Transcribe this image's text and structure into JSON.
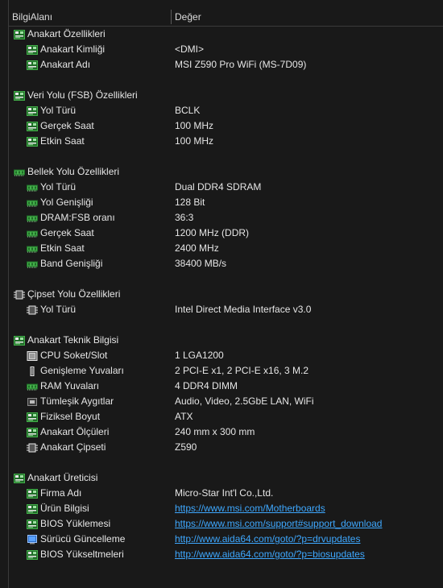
{
  "header": {
    "col_field": "BilgiAlanı",
    "col_value": "Değer"
  },
  "groups": [
    {
      "title": "Anakart Özellikleri",
      "icon": "board-icon",
      "items": [
        {
          "label": "Anakart Kimliği",
          "value": "<DMI>",
          "icon": "board-icon"
        },
        {
          "label": "Anakart Adı",
          "value": "MSI Z590 Pro WiFi (MS-7D09)",
          "icon": "board-icon"
        }
      ]
    },
    {
      "title": "Veri Yolu (FSB) Özellikleri",
      "icon": "board-icon",
      "items": [
        {
          "label": "Yol Türü",
          "value": "BCLK",
          "icon": "board-icon"
        },
        {
          "label": "Gerçek Saat",
          "value": "100 MHz",
          "icon": "board-icon"
        },
        {
          "label": "Etkin Saat",
          "value": "100 MHz",
          "icon": "board-icon"
        }
      ]
    },
    {
      "title": "Bellek Yolu Özellikleri",
      "icon": "memory-icon",
      "items": [
        {
          "label": "Yol Türü",
          "value": "Dual DDR4 SDRAM",
          "icon": "memory-icon"
        },
        {
          "label": "Yol Genişliği",
          "value": "128 Bit",
          "icon": "memory-icon"
        },
        {
          "label": "DRAM:FSB oranı",
          "value": "36:3",
          "icon": "memory-icon"
        },
        {
          "label": "Gerçek Saat",
          "value": "1200 MHz (DDR)",
          "icon": "memory-icon"
        },
        {
          "label": "Etkin Saat",
          "value": "2400 MHz",
          "icon": "memory-icon"
        },
        {
          "label": "Band Genişliği",
          "value": "38400 MB/s",
          "icon": "memory-icon"
        }
      ]
    },
    {
      "title": "Çipset Yolu Özellikleri",
      "icon": "chipset-icon",
      "items": [
        {
          "label": "Yol Türü",
          "value": "Intel Direct Media Interface v3.0",
          "icon": "chipset-icon"
        }
      ]
    },
    {
      "title": "Anakart Teknik Bilgisi",
      "icon": "board-icon",
      "items": [
        {
          "label": "CPU Soket/Slot",
          "value": "1 LGA1200",
          "icon": "cpu-socket-icon"
        },
        {
          "label": "Genişleme Yuvaları",
          "value": "2 PCI-E x1, 2 PCI-E x16, 3 M.2",
          "icon": "expansion-slot-icon"
        },
        {
          "label": "RAM Yuvaları",
          "value": "4 DDR4 DIMM",
          "icon": "memory-icon"
        },
        {
          "label": "Tümleşik Aygıtlar",
          "value": "Audio, Video, 2.5GbE LAN, WiFi",
          "icon": "integrated-device-icon"
        },
        {
          "label": "Fiziksel Boyut",
          "value": "ATX",
          "icon": "board-icon"
        },
        {
          "label": "Anakart Ölçüleri",
          "value": "240 mm x 300 mm",
          "icon": "board-icon"
        },
        {
          "label": "Anakart Çipseti",
          "value": "Z590",
          "icon": "chipset-icon"
        }
      ]
    },
    {
      "title": "Anakart Üreticisi",
      "icon": "board-icon",
      "items": [
        {
          "label": "Firma Adı",
          "value": "Micro-Star Int'l Co.,Ltd.",
          "icon": "board-icon"
        },
        {
          "label": "Ürün Bilgisi",
          "value": "https://www.msi.com/Motherboards",
          "icon": "board-icon",
          "link": true
        },
        {
          "label": "BIOS Yüklemesi",
          "value": "https://www.msi.com/support#support_download",
          "icon": "board-icon",
          "link": true
        },
        {
          "label": "Sürücü Güncelleme",
          "value": "http://www.aida64.com/goto/?p=drvupdates",
          "icon": "driver-update-icon",
          "link": true
        },
        {
          "label": "BIOS Yükseltmeleri",
          "value": "http://www.aida64.com/goto/?p=biosupdates",
          "icon": "board-icon",
          "link": true
        }
      ]
    }
  ]
}
